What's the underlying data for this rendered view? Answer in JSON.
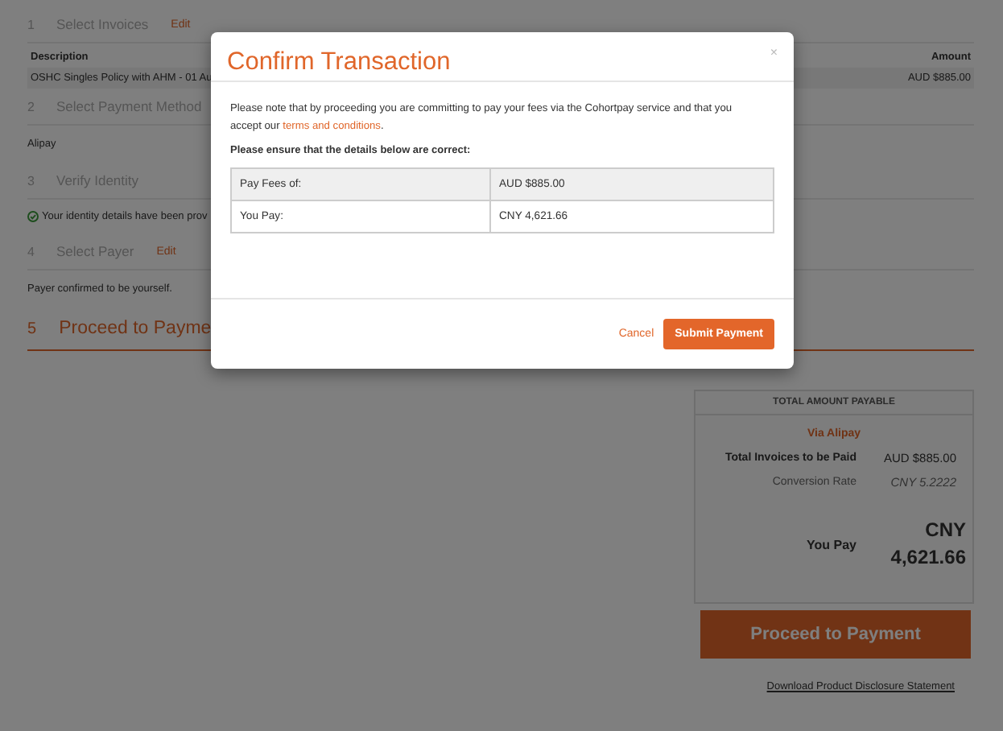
{
  "steps": [
    {
      "number": "1",
      "title": "Select Invoices",
      "action": "Edit",
      "kind": "table",
      "columns": [
        "Description",
        "Amount"
      ],
      "rows": [
        [
          "OSHC Singles Policy with AHM - 01 Au",
          "AUD $885.00"
        ]
      ]
    },
    {
      "number": "2",
      "title": "Select Payment Method",
      "kind": "text",
      "text": "Alipay"
    },
    {
      "number": "3",
      "title": "Verify Identity",
      "kind": "verified",
      "text": "Your identity details have been prov"
    },
    {
      "number": "4",
      "title": "Select Payer",
      "action": "Edit",
      "kind": "text",
      "text": "Payer confirmed to be yourself."
    },
    {
      "number": "5",
      "title": "Proceed to Payme",
      "kind": "current"
    }
  ],
  "summary": {
    "heading": "TOTAL AMOUNT PAYABLE",
    "method": "Via Alipay",
    "rows": [
      {
        "label": "Total Invoices to be Paid",
        "value": "AUD $885.00",
        "kind": "strong"
      },
      {
        "label": "Conversion Rate",
        "value": "CNY 5.2222",
        "kind": "plain"
      },
      {
        "label": "You Pay",
        "value": "CNY 4,621.66",
        "kind": "total"
      }
    ],
    "button": "Proceed to Payment",
    "link": "Download Product Disclosure Statement"
  },
  "modal": {
    "title": "Confirm Transaction",
    "close": "×",
    "text_before": "Please note that by proceeding you are committing to pay your fees via the Cohortpay service and that you accept our ",
    "link": "terms and conditions",
    "text_after": ".",
    "details_heading": "Please ensure that the details below are correct:",
    "rows": [
      {
        "label": "Pay Fees of:",
        "value": "AUD $885.00",
        "shaded": true
      },
      {
        "label": "You Pay:",
        "value": "CNY 4,621.66",
        "shaded": false
      }
    ],
    "cancel": "Cancel",
    "submit": "Submit Payment"
  }
}
